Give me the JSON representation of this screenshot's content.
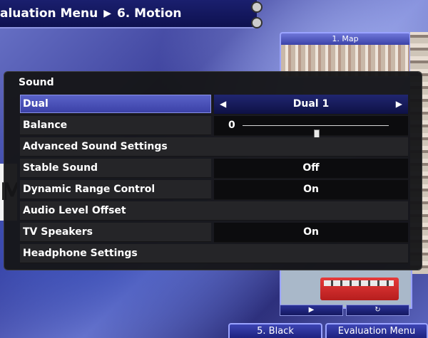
{
  "breadcrumb": {
    "parent": "aluation Menu",
    "separator": "▶",
    "current": "6. Motion"
  },
  "map_panel": {
    "title": "1. Map"
  },
  "bottom_tabs": [
    "5. Black",
    "Evaluation Menu"
  ],
  "left_fragment": "M",
  "panel": {
    "title": "Sound",
    "rows": [
      {
        "label": "Dual",
        "value": "Dual 1",
        "selected": true
      },
      {
        "label": "Balance",
        "value": "0",
        "slider_level": 0.5
      },
      {
        "label": "Advanced Sound Settings"
      },
      {
        "label": "Stable Sound",
        "value": "Off"
      },
      {
        "label": "Dynamic Range Control",
        "value": "On"
      },
      {
        "label": "Audio Level Offset"
      },
      {
        "label": "TV Speakers",
        "value": "On"
      },
      {
        "label": "Headphone Settings"
      }
    ]
  },
  "colors": {
    "selected_row": "#5b63c9",
    "panel_bg": "#161618",
    "accent": "#9aa3ff"
  },
  "icons": {
    "left_arrow": "◀",
    "right_arrow": "▶",
    "play": "▶",
    "repeat": "↻"
  }
}
